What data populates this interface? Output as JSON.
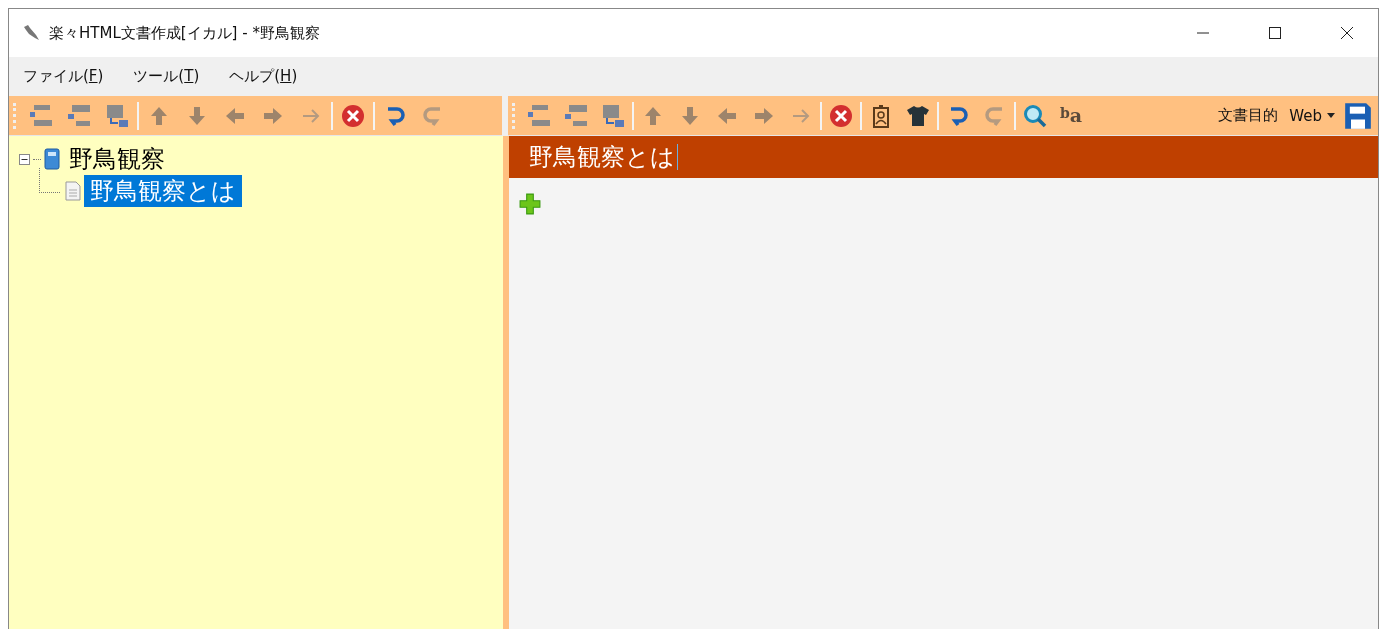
{
  "window": {
    "title": "楽々HTML文書作成[イカル] - *野鳥観察"
  },
  "menu": [
    {
      "label": "ファイル(",
      "key": "F",
      "end": ")"
    },
    {
      "label": "ツール(",
      "key": "T",
      "end": ")"
    },
    {
      "label": "ヘルプ(",
      "key": "H",
      "end": ")"
    }
  ],
  "left_toolbar": [
    {
      "kind": "layout1",
      "disabled": false
    },
    {
      "kind": "layout2",
      "disabled": false
    },
    {
      "kind": "layout3",
      "disabled": false
    },
    {
      "kind": "sep"
    },
    {
      "kind": "up",
      "disabled": true
    },
    {
      "kind": "down",
      "disabled": true
    },
    {
      "kind": "left",
      "disabled": true
    },
    {
      "kind": "right",
      "disabled": true
    },
    {
      "kind": "thin-right",
      "disabled": true
    },
    {
      "kind": "sep"
    },
    {
      "kind": "delete",
      "disabled": false
    },
    {
      "kind": "sep"
    },
    {
      "kind": "undo",
      "disabled": false
    },
    {
      "kind": "redo",
      "disabled": true
    }
  ],
  "right_toolbar": [
    {
      "kind": "layout1",
      "disabled": false
    },
    {
      "kind": "layout2",
      "disabled": false
    },
    {
      "kind": "layout3",
      "disabled": false
    },
    {
      "kind": "sep"
    },
    {
      "kind": "up",
      "disabled": true
    },
    {
      "kind": "down",
      "disabled": true
    },
    {
      "kind": "left",
      "disabled": true
    },
    {
      "kind": "right",
      "disabled": true
    },
    {
      "kind": "thin-right",
      "disabled": true
    },
    {
      "kind": "sep"
    },
    {
      "kind": "delete",
      "disabled": false
    },
    {
      "kind": "sep"
    },
    {
      "kind": "portrait",
      "disabled": false
    },
    {
      "kind": "shirt",
      "disabled": false
    },
    {
      "kind": "sep"
    },
    {
      "kind": "undo",
      "disabled": false
    },
    {
      "kind": "redo",
      "disabled": true
    },
    {
      "kind": "sep"
    },
    {
      "kind": "search",
      "disabled": false
    },
    {
      "kind": "ruby",
      "text_base": "b",
      "text_ruby": "a",
      "disabled": false
    }
  ],
  "purpose": {
    "label": "文書目的",
    "value": "Web"
  },
  "tree": [
    {
      "label": "野鳥観察",
      "expanded": true,
      "selected": false,
      "children": [
        {
          "label": "野鳥観察とは",
          "selected": true
        }
      ]
    }
  ],
  "editor": {
    "heading": "野鳥観察とは"
  }
}
